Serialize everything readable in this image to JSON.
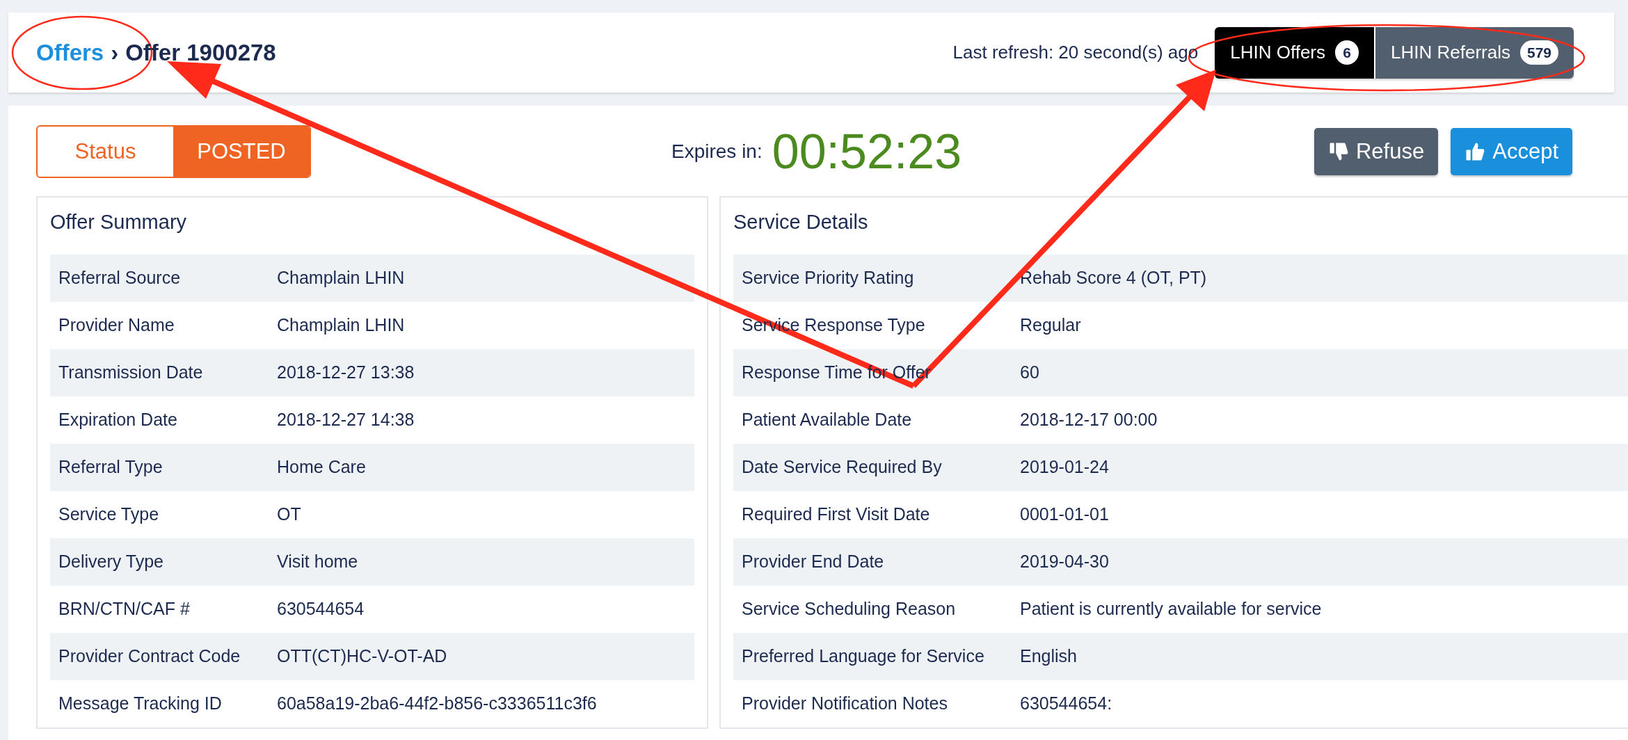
{
  "breadcrumb": {
    "link": "Offers",
    "separator": "›",
    "current": "Offer 1900278"
  },
  "last_refresh": "Last refresh: 20 second(s) ago",
  "tabs": [
    {
      "label": "LHIN Offers",
      "count": "6",
      "selected": true
    },
    {
      "label": "LHIN Referrals",
      "count": "579",
      "selected": false
    }
  ],
  "status": {
    "label": "Status",
    "value": "POSTED"
  },
  "expires": {
    "label": "Expires in:",
    "time": "00:52:23"
  },
  "actions": [
    {
      "kind": "refuse",
      "label": "Refuse"
    },
    {
      "kind": "accept",
      "label": "Accept"
    }
  ],
  "panels": [
    {
      "title": "Offer Summary",
      "rows": [
        {
          "label": "Referral Source",
          "value": "Champlain LHIN"
        },
        {
          "label": "Provider Name",
          "value": "Champlain LHIN"
        },
        {
          "label": "Transmission Date",
          "value": "2018-12-27 13:38"
        },
        {
          "label": "Expiration Date",
          "value": "2018-12-27 14:38"
        },
        {
          "label": "Referral Type",
          "value": "Home Care"
        },
        {
          "label": "Service Type",
          "value": "OT"
        },
        {
          "label": "Delivery Type",
          "value": "Visit home"
        },
        {
          "label": "BRN/CTN/CAF #",
          "value": "630544654"
        },
        {
          "label": "Provider Contract Code",
          "value": "OTT(CT)HC-V-OT-AD"
        },
        {
          "label": "Message Tracking ID",
          "value": "60a58a19-2ba6-44f2-b856-c3336511c3f6"
        }
      ]
    },
    {
      "title": "Service Details",
      "rows": [
        {
          "label": "Service Priority Rating",
          "value": "Rehab Score 4 (OT, PT)"
        },
        {
          "label": "Service Response Type",
          "value": "Regular"
        },
        {
          "label": "Response Time for Offer",
          "value": "60"
        },
        {
          "label": "Patient Available Date",
          "value": "2018-12-17 00:00"
        },
        {
          "label": "Date Service Required By",
          "value": "2019-01-24"
        },
        {
          "label": "Required First Visit Date",
          "value": "0001-01-01"
        },
        {
          "label": "Provider End Date",
          "value": "2019-04-30"
        },
        {
          "label": "Service Scheduling Reason",
          "value": "Patient is currently available for service"
        },
        {
          "label": "Preferred Language for Service",
          "value": "English"
        },
        {
          "label": "Provider Notification Notes",
          "value": "630544654:"
        }
      ]
    }
  ]
}
